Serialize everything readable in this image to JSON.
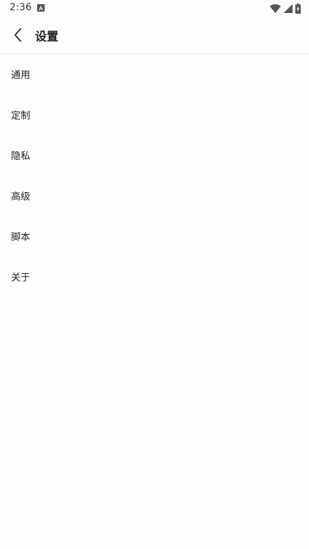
{
  "status_bar": {
    "time": "2:36",
    "icons": [
      "notification-a-icon",
      "wifi-icon",
      "signal-icon",
      "battery-charging-icon"
    ]
  },
  "toolbar": {
    "back_icon": "chevron-left-icon",
    "title": "设置"
  },
  "settings": {
    "items": [
      {
        "label": "通用"
      },
      {
        "label": "定制"
      },
      {
        "label": "隐私"
      },
      {
        "label": "高级"
      },
      {
        "label": "脚本"
      },
      {
        "label": "关于"
      }
    ]
  },
  "colors": {
    "background": "#fdfdfd",
    "text": "#222222",
    "divider": "#e6e6e6"
  }
}
